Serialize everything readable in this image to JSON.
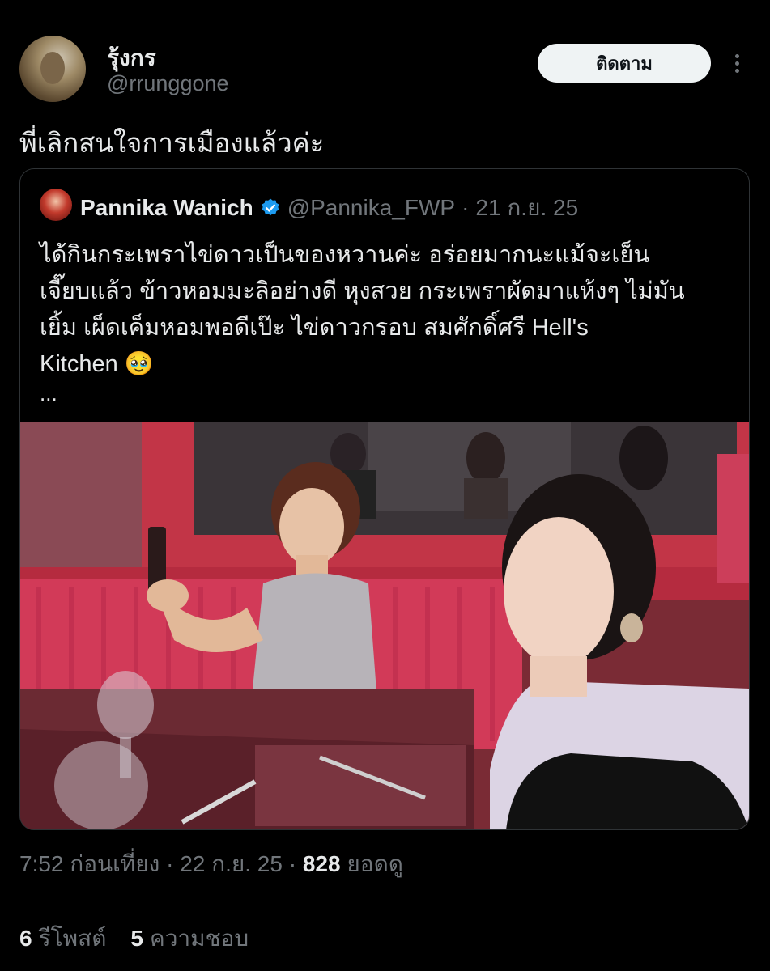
{
  "author": {
    "display_name": "รุ้งกร",
    "handle": "@rrunggone",
    "avatar_icon": "user-avatar"
  },
  "follow_label": "ติดตาม",
  "more_icon": "more-dots-icon",
  "tweet_text": "พี่เลิกสนใจการเมืองแล้วค่ะ",
  "quoted": {
    "display_name": "Pannika Wanich",
    "verified": true,
    "verified_icon": "verified-badge-icon",
    "handle": "@Pannika_FWP",
    "separator": "·",
    "date": "21 ก.ย. 25",
    "text": "ได้กินกระเพราไข่ดาวเป็นของหวานค่ะ อร่อยมากนะแม้จะเย็น\nเจี๊ยบแล้ว ข้าวหอมมะลิอย่างดี หุงสวย กระเพราผัดมาแห้งๆ ไม่มัน\nเยิ้ม เผ็ดเค็มหอมพอดีเป๊ะ ไข่ดาวกรอบ สมศักดิ์ศรี Hell's\nKitchen 🥹",
    "truncation": "...",
    "photo": "selfie-restaurant-photo"
  },
  "meta": {
    "time": "7:52 ก่อนเที่ยง",
    "separator": "·",
    "date": "22 ก.ย. 25",
    "views": "828",
    "views_label": "ยอดดู"
  },
  "stats": {
    "reposts": "6",
    "reposts_label": "รีโพสต์",
    "likes": "5",
    "likes_label": "ความชอบ"
  },
  "colors": {
    "background": "#000000",
    "text": "#e7e9ea",
    "muted": "#71767b",
    "border": "#2f3336",
    "verified": "#1d9bf0",
    "follow_bg": "#eff3f4"
  }
}
